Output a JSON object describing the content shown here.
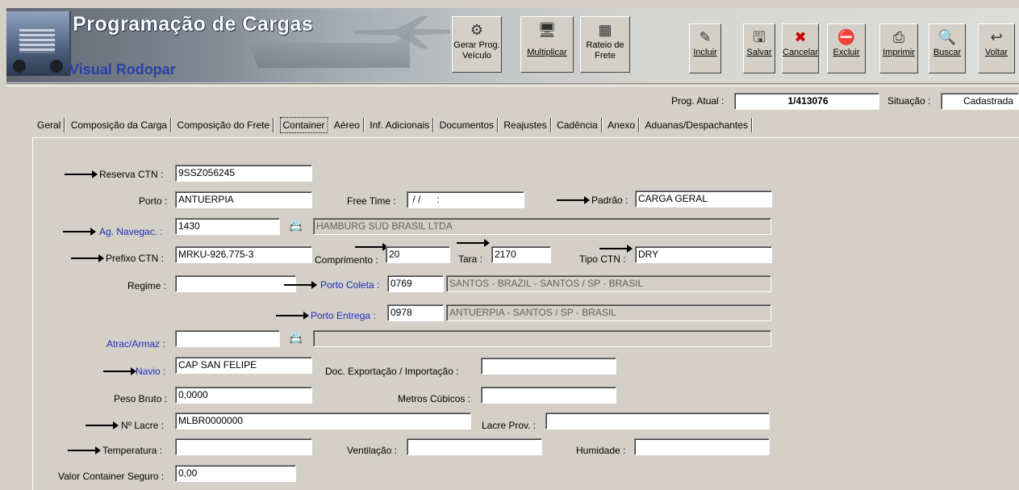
{
  "app": {
    "title": "Programação de Cargas",
    "subtitle": "Visual Rodopar"
  },
  "toolbar_main": [
    {
      "label": "Gerar Prog.",
      "label2": "Veículo",
      "icon": "gear-truck-icon"
    },
    {
      "label": "Multiplicar",
      "icon": "computer-icon"
    },
    {
      "label": "Rateio de",
      "label2": "Frete",
      "icon": "split-icon"
    }
  ],
  "toolbar_actions": [
    {
      "label": "Incluir",
      "icon": "new-icon"
    },
    {
      "label": "Salvar",
      "icon": "save-icon"
    },
    {
      "label": "Cancelar",
      "icon": "cancel-icon"
    },
    {
      "label": "Excluir",
      "icon": "delete-icon"
    },
    {
      "label": "Imprimir",
      "icon": "print-icon"
    },
    {
      "label": "Buscar",
      "icon": "search-icon"
    },
    {
      "label": "Voltar",
      "icon": "back-icon"
    }
  ],
  "header": {
    "prog_label": "Prog. Atual :",
    "prog_value": "1/413076",
    "situacao_label": "Situação :",
    "situacao_value": "Cadastrada"
  },
  "tabs": [
    "Geral",
    "Composição da Carga",
    "Composição do Frete",
    "Container",
    "Aéreo",
    "Inf. Adicionais",
    "Documentos",
    "Reajustes",
    "Cadência",
    "Anexo",
    "Aduanas/Despachantes"
  ],
  "form": {
    "reserva_label": "Reserva CTN :",
    "reserva_value": "9SSZ056245",
    "porto_label": "Porto :",
    "porto_value": "ANTUERPIA",
    "freetime_label": "Free Time :",
    "freetime_value": " / /      :",
    "padrao_label": "Padrão :",
    "padrao_value": "CARGA GERAL",
    "agnav_label": "Ag. Navegac. :",
    "agnav_code": "1430",
    "agnav_name": "HAMBURG SUD BRASIL LTDA",
    "prefixo_label": "Prefixo CTN :",
    "prefixo_value": "MRKU-926.775-3",
    "comprimento_label": "Comprimento :",
    "comprimento_value": "20",
    "tara_label": "Tara :",
    "tara_value": "2170",
    "tipo_label": "Tipo CTN :",
    "tipo_value": "DRY",
    "regime_label": "Regime :",
    "regime_value": "",
    "coleta_label": "Porto Coleta :",
    "coleta_code": "0769",
    "coleta_name": "SANTOS - BRAZIL - SANTOS / SP - BRASIL",
    "entrega_label": "Porto Entrega :",
    "entrega_code": "0978",
    "entrega_name": "ANTUERPIA - SANTOS / SP - BRASIL",
    "atrac_label": "Atrac/Armaz :",
    "atrac_code": "",
    "atrac_name": "",
    "navio_label": "Navio :",
    "navio_value": "CAP SAN FELIPE",
    "docexp_label": "Doc. Exportação / Importação :",
    "docexp_value": "",
    "peso_label": "Peso Bruto :",
    "peso_value": "0,0000",
    "metros_label": "Metros Cúbicos :",
    "metros_value": "",
    "lacre_label": "Nº Lacre :",
    "lacre_value": "MLBR0000000",
    "lacreprov_label": "Lacre Prov. :",
    "lacreprov_value": "",
    "temp_label": "Temperatura :",
    "temp_value": "",
    "vent_label": "Ventilação :",
    "vent_value": "",
    "umid_label": "Humidade :",
    "umid_value": "",
    "valor_label": "Valor Container Seguro :",
    "valor_value": "0,00"
  }
}
